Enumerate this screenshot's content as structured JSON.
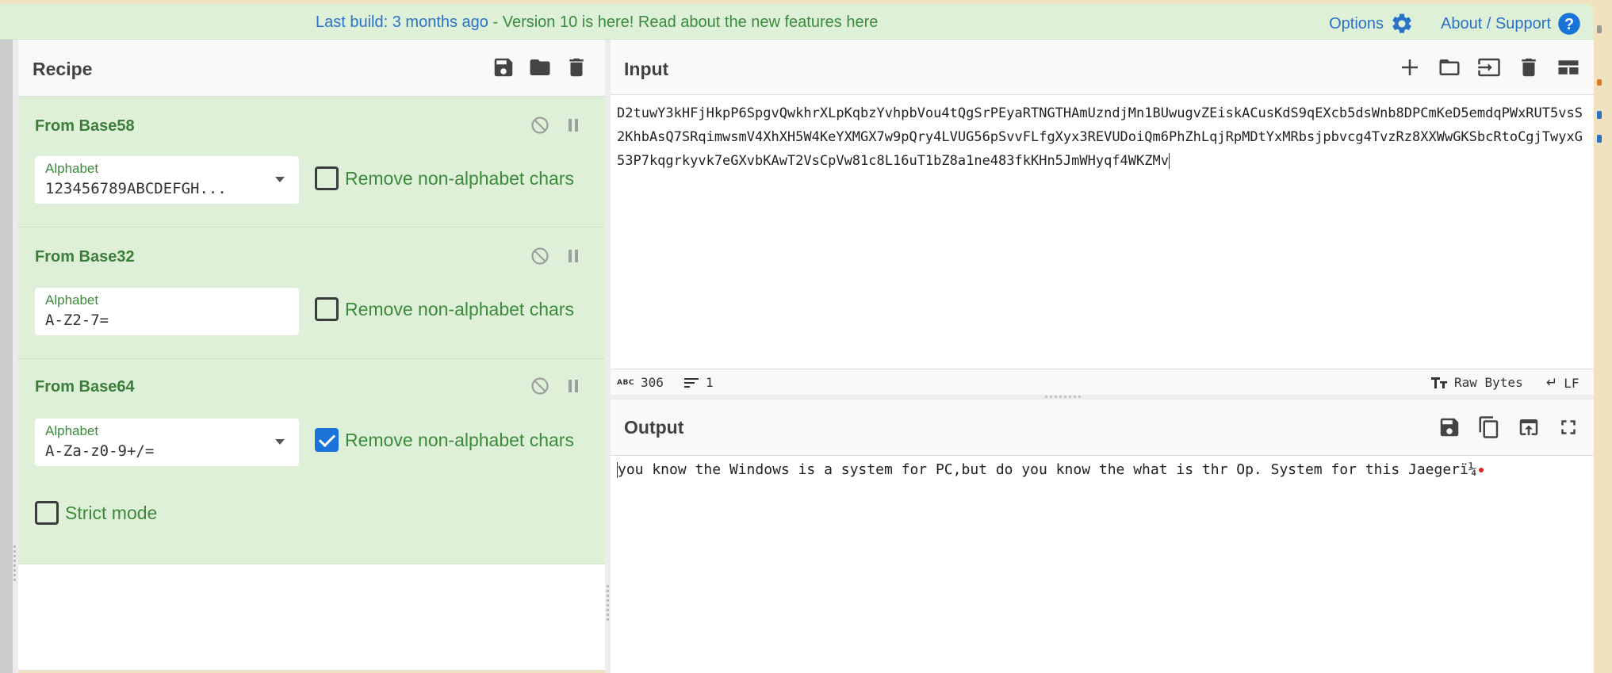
{
  "banner": {
    "build_text": "Last build: 3 months ago",
    "separator": " - ",
    "version_text": "Version 10 is here! Read about the new features here",
    "options_label": "Options",
    "about_label": "About / Support"
  },
  "recipe": {
    "title": "Recipe",
    "icons": [
      "save-icon",
      "folder-icon",
      "trash-icon"
    ],
    "operations": [
      {
        "name": "From Base58",
        "field_label": "Alphabet",
        "field_value": "123456789ABCDEFGH...",
        "has_dropdown": true,
        "checkbox_label": "Remove non-alphabet chars",
        "checked": false
      },
      {
        "name": "From Base32",
        "field_label": "Alphabet",
        "field_value": "A-Z2-7=",
        "has_dropdown": false,
        "checkbox_label": "Remove non-alphabet chars",
        "checked": false
      },
      {
        "name": "From Base64",
        "field_label": "Alphabet",
        "field_value": "A-Za-z0-9+/=",
        "has_dropdown": true,
        "checkbox_label": "Remove non-alphabet chars",
        "checked": true,
        "extra_checkbox_label": "Strict mode",
        "extra_checked": false
      }
    ]
  },
  "input": {
    "title": "Input",
    "icons": [
      "plus-icon",
      "folder-icon",
      "import-icon",
      "trash-icon",
      "layout-icon"
    ],
    "text": "D2tuwY3kHFjHkpP6SpgvQwkhrXLpKqbzYvhpbVou4tQgSrPEyaRTNGTHAmUzndjMn1BUwugvZEiskACusKdS9qEXcb5dsWnb8DPCmKeD5emdqPWxRUT5vsS2KhbAsQ7SRqimwsmV4XhXH5W4KeYXMGX7w9pQry4LVUG56pSvvFLfgXyx3REVUDoiQm6PhZhLqjRpMDtYxMRbsjpbvcg4TvzRz8XXWwGKSbcRtoCgjTwyxG53P7kqgrkyvk7eGXvbKAwT2VsCpVw81c8L16uT1bZ8a1ne483fkKHn5JmWHyqf4WKZMv",
    "status": {
      "char_count": "306",
      "line_count": "1",
      "encoding": "Raw Bytes",
      "eol": "LF"
    }
  },
  "output": {
    "title": "Output",
    "icons": [
      "save-icon",
      "copy-icon",
      "replace-input-icon",
      "maximize-icon"
    ],
    "text": "you know the Windows is a system for PC,but do you know the what is thr Op. System for this Jaegerï¼"
  },
  "colors": {
    "banner_bg": "#dff0d8",
    "op_bg": "#dff0d8",
    "op_title": "#3b7d3b",
    "link_blue": "#2a72c7",
    "checkbox_checked": "#1a73d9",
    "page_bg": "#f0e2bf"
  }
}
